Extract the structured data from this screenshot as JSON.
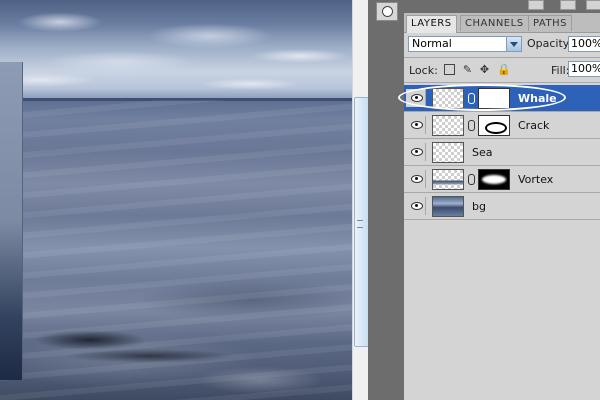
{
  "layers_panel": {
    "tabs": [
      {
        "label": "LAYERS",
        "active": true
      },
      {
        "label": "CHANNELS",
        "active": false
      },
      {
        "label": "PATHS",
        "active": false
      }
    ],
    "blend_mode": "Normal",
    "opacity_label": "Opacity:",
    "opacity_value": "100%",
    "lock_label": "Lock:",
    "fill_label": "Fill:",
    "fill_value": "100%",
    "lock_icons": [
      "lock-transparent-icon",
      "lock-paint-icon",
      "lock-move-icon",
      "lock-all-icon"
    ],
    "layers": [
      {
        "name": "Whale",
        "selected": true,
        "thumbnail": "transparent",
        "has_mask": true,
        "mask": "white"
      },
      {
        "name": "Crack",
        "selected": false,
        "thumbnail": "transparent",
        "has_mask": true,
        "mask": "crack"
      },
      {
        "name": "Sea",
        "selected": false,
        "thumbnail": "transparent",
        "has_mask": false
      },
      {
        "name": "Vortex",
        "selected": false,
        "thumbnail": "vortex",
        "has_mask": true,
        "mask": "vortex"
      },
      {
        "name": "bg",
        "selected": false,
        "thumbnail": "photo",
        "has_mask": false
      }
    ]
  },
  "colors": {
    "selected_layer": "#2e61b8",
    "panel_bg": "#d4d4d4",
    "canvas_frame": "#6d6d6d"
  }
}
